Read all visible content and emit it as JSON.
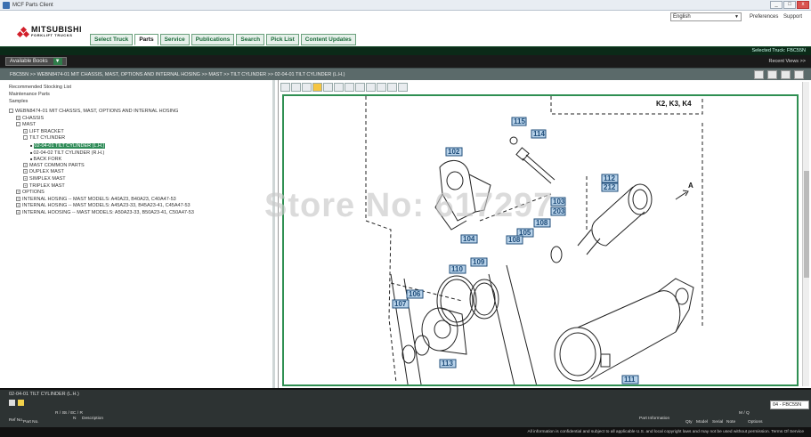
{
  "window": {
    "title": "MCF Parts Client",
    "controls": [
      "_",
      "□",
      "x"
    ]
  },
  "header": {
    "brand": "MITSUBISHI",
    "brand_sub": "FORKLIFT TRUCKS",
    "language": "English",
    "links": [
      "Preferences",
      "Support"
    ],
    "tabs": [
      "Select Truck",
      "Parts",
      "Service",
      "Publications",
      "Search",
      "Pick List",
      "Content Updates"
    ],
    "active_tab": "Parts"
  },
  "selected_truck": "Selected Truck:  FBC55N",
  "books": {
    "label": "Available Books",
    "recent": "Recent Views >>"
  },
  "breadcrumb": "FBC55N >> WEBN8474-01 MIT CHASSIS, MAST, OPTIONS AND INTERNAL HOSING >> MAST >> TILT CYLINDER >> 02-04-01 TILT CYLINDER (L.H.)",
  "left": {
    "links": [
      "Recommended Stocking List",
      "Maintenance Parts",
      "Samples"
    ],
    "tree": [
      {
        "label": "WEBN8474-01 MIT CHASSIS, MAST, OPTIONS AND INTERNAL HOSING",
        "indent": 0,
        "exp": "-"
      },
      {
        "label": "CHASSIS",
        "indent": 1,
        "exp": "+"
      },
      {
        "label": "MAST",
        "indent": 1,
        "exp": "-"
      },
      {
        "label": "LIFT BRACKET",
        "indent": 2,
        "exp": "+"
      },
      {
        "label": "TILT CYLINDER",
        "indent": 2,
        "exp": "-"
      },
      {
        "label": "02-04-01 TILT CYLINDER (L.H.)",
        "indent": 3,
        "exp": "",
        "highlight": true
      },
      {
        "label": "02-04-02 TILT CYLINDER (R.H.)",
        "indent": 3,
        "exp": ""
      },
      {
        "label": "BACK FORK",
        "indent": 3,
        "exp": ""
      },
      {
        "label": "MAST COMMON PARTS",
        "indent": 2,
        "exp": "+"
      },
      {
        "label": "DUPLEX MAST",
        "indent": 2,
        "exp": "+"
      },
      {
        "label": "SIMPLEX MAST",
        "indent": 2,
        "exp": "+"
      },
      {
        "label": "TRIPLEX MAST",
        "indent": 2,
        "exp": "+"
      },
      {
        "label": "OPTIONS",
        "indent": 1,
        "exp": "+"
      },
      {
        "label": "INTERNAL HOSING -- MAST MODELS: A40A23, B40A23, C40A47-53",
        "indent": 1,
        "exp": "+"
      },
      {
        "label": "INTERNAL HOSING -- MAST MODELS: A45A23-33, B45A23-41, C45A47-53",
        "indent": 1,
        "exp": "+"
      },
      {
        "label": "INTERNAL HOOSING -- MAST MODELS: A50A23-33, B50A23-41, C50A47-53",
        "indent": 1,
        "exp": "+"
      }
    ]
  },
  "drawing": {
    "corner_text": "K2, K3, K4",
    "arrow_label": "A",
    "callouts": [
      "115",
      "114",
      "102",
      "103",
      "203",
      "112",
      "212",
      "104",
      "105",
      "108",
      "108",
      "109",
      "110",
      "106",
      "107",
      "113",
      "111"
    ]
  },
  "watermark": "Store No: 617297",
  "bottom": {
    "title": "02-04-01 TILT CYLINDER (L.H.)",
    "model": "04 - FBC55N",
    "columns": [
      "Ref No.",
      "Part No.",
      "R / S",
      "S / E",
      "C / R",
      "N",
      "Description",
      "Part Information",
      "Qty",
      "Model",
      "Serial",
      "Note",
      "M / Q",
      "Options"
    ]
  },
  "footer": "All information is confidential and subject to all applicable U.S. and local copyright laws and may not be used without permission.  Terms Of Service"
}
